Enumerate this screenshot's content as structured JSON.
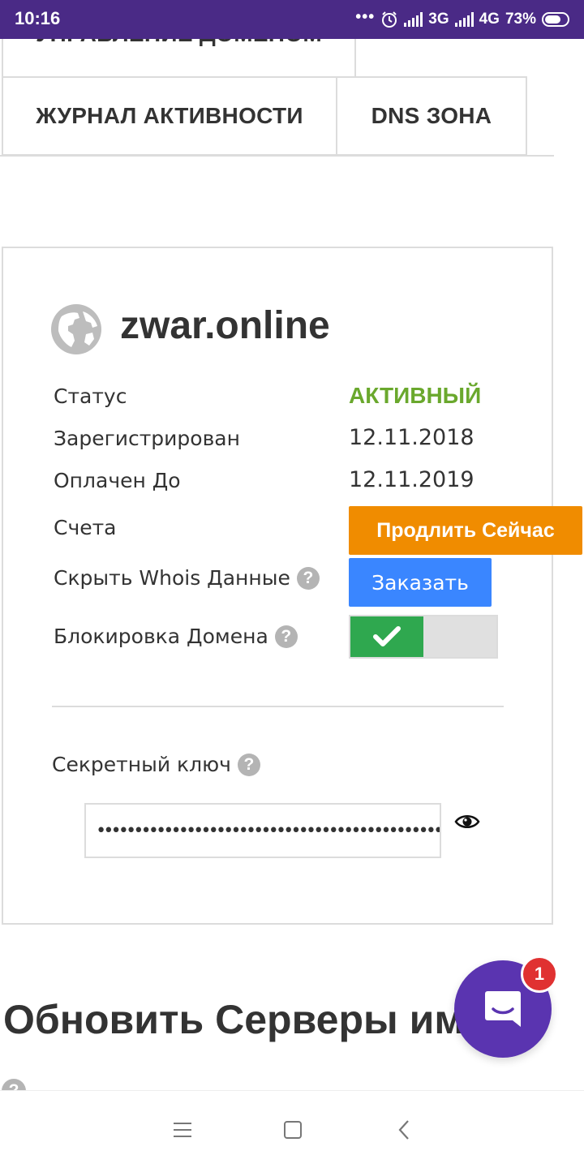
{
  "status_bar": {
    "time": "10:16",
    "dots": "•••",
    "network_1": "3G",
    "network_2": "4G",
    "battery": "73%"
  },
  "tabs": {
    "domain_management": "УПРАВЛЕНИЕ ДОМЕНОМ",
    "activity_log": "ЖУРНАЛ АКТИВНОСТИ",
    "dns_zone": "DNS ЗОНА"
  },
  "domain": {
    "name": "zwar.online",
    "status_label": "Статус",
    "status_value": "АКТИВНЫЙ",
    "registered_label": "Зарегистрирован",
    "registered_value": "12.11.2018",
    "paid_until_label": "Оплачен До",
    "paid_until_value": "12.11.2019",
    "invoices_label": "Счета",
    "renew_button": "Продлить Сейчас",
    "whois_label": "Скрыть Whois Данные",
    "order_button": "Заказать",
    "lock_label": "Блокировка Домена",
    "secret_label": "Секретный ключ",
    "secret_value": "••••••••••••••••••••••••••••••••••••••••••••••••••••••••"
  },
  "nameservers": {
    "heading": "Обновить Серверы им"
  },
  "help_glyph": "?",
  "chat": {
    "badge": "1"
  },
  "colors": {
    "status_bar": "#4a2a86",
    "active_status": "#6aa82d",
    "renew": "#f08c00",
    "order": "#3a86ff",
    "toggle_on": "#2fa84f",
    "chat": "#5a34b0",
    "badge": "#e03131"
  }
}
